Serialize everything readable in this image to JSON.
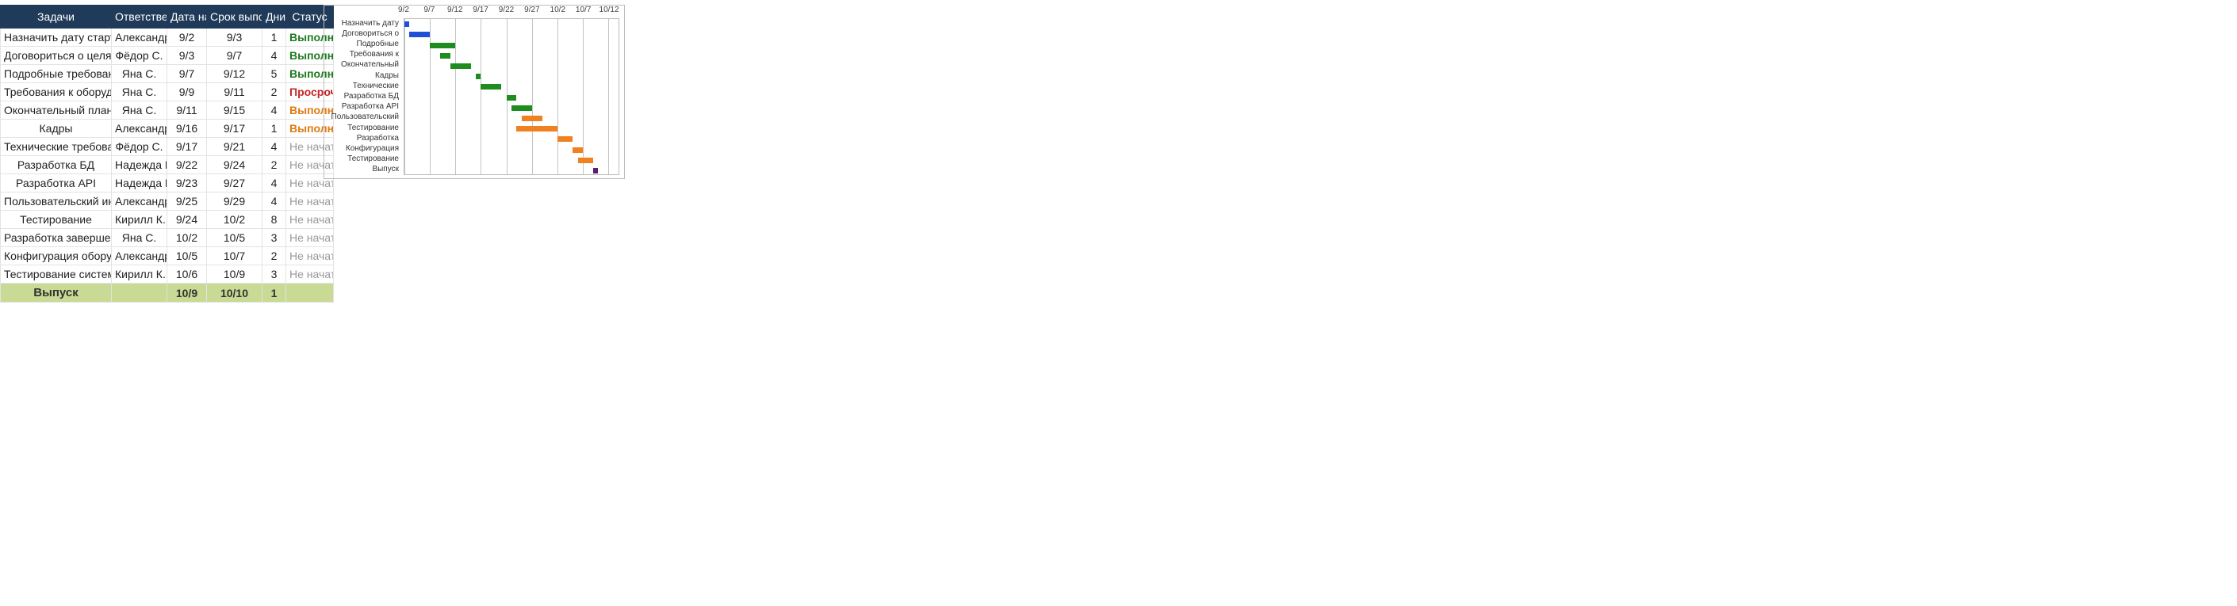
{
  "table": {
    "headers": {
      "task": "Задачи",
      "owner": "Ответственное лицо",
      "start": "Дата начала",
      "end": "Срок выполнения",
      "days": "Дни",
      "status": "Статус"
    },
    "rows": [
      {
        "task": "Назначить дату стартового совещания",
        "owner": "Александр Б.",
        "start": "9/2",
        "end": "9/3",
        "days": "1",
        "status": "Выполнено",
        "status_kind": "done"
      },
      {
        "task": "Договориться о целях",
        "owner": "Фёдор С.",
        "start": "9/3",
        "end": "9/7",
        "days": "4",
        "status": "Выполнено",
        "status_kind": "done"
      },
      {
        "task": "Подробные требования",
        "owner": "Яна С.",
        "start": "9/7",
        "end": "9/12",
        "days": "5",
        "status": "Выполнено",
        "status_kind": "done"
      },
      {
        "task": "Требования к оборудованию",
        "owner": "Яна С.",
        "start": "9/9",
        "end": "9/11",
        "days": "2",
        "status": "Просрочено",
        "status_kind": "late"
      },
      {
        "task": "Окончательный план ресурсов",
        "owner": "Яна С.",
        "start": "9/11",
        "end": "9/15",
        "days": "4",
        "status": "Выполняется",
        "status_kind": "progress"
      },
      {
        "task": "Кадры",
        "owner": "Александр Б.",
        "start": "9/16",
        "end": "9/17",
        "days": "1",
        "status": "Выполняется",
        "status_kind": "progress"
      },
      {
        "task": "Технические требования",
        "owner": "Фёдор С.",
        "start": "9/17",
        "end": "9/21",
        "days": "4",
        "status": "Не начато",
        "status_kind": "none"
      },
      {
        "task": "Разработка БД",
        "owner": "Надежда В.",
        "start": "9/22",
        "end": "9/24",
        "days": "2",
        "status": "Не начато",
        "status_kind": "none"
      },
      {
        "task": "Разработка API",
        "owner": "Надежда В.",
        "start": "9/23",
        "end": "9/27",
        "days": "4",
        "status": "Не начато",
        "status_kind": "none"
      },
      {
        "task": "Пользовательский интерфейс клиента",
        "owner": "Александр Б.",
        "start": "9/25",
        "end": "9/29",
        "days": "4",
        "status": "Не начато",
        "status_kind": "none"
      },
      {
        "task": "Тестирование",
        "owner": "Кирилл К.",
        "start": "9/24",
        "end": "10/2",
        "days": "8",
        "status": "Не начато",
        "status_kind": "none"
      },
      {
        "task": "Разработка завершена",
        "owner": "Яна С.",
        "start": "10/2",
        "end": "10/5",
        "days": "3",
        "status": "Не начато",
        "status_kind": "none"
      },
      {
        "task": "Конфигурация оборудования",
        "owner": "Александр Б.",
        "start": "10/5",
        "end": "10/7",
        "days": "2",
        "status": "Не начато",
        "status_kind": "none"
      },
      {
        "task": "Тестирование системы",
        "owner": "Кирилл К.",
        "start": "10/6",
        "end": "10/9",
        "days": "3",
        "status": "Не начато",
        "status_kind": "none"
      },
      {
        "task": "Выпуск",
        "owner": "",
        "start": "10/9",
        "end": "10/10",
        "days": "1",
        "status": "",
        "status_kind": "release"
      }
    ]
  },
  "chart_data": {
    "type": "bar",
    "orientation": "horizontal-gantt",
    "axis": {
      "min": 0,
      "max": 42
    },
    "ticks": [
      {
        "label": "9/2",
        "day": 0
      },
      {
        "label": "9/7",
        "day": 5
      },
      {
        "label": "9/12",
        "day": 10
      },
      {
        "label": "9/17",
        "day": 15
      },
      {
        "label": "9/22",
        "day": 20
      },
      {
        "label": "9/27",
        "day": 25
      },
      {
        "label": "10/2",
        "day": 30
      },
      {
        "label": "10/7",
        "day": 35
      },
      {
        "label": "10/12",
        "day": 40
      }
    ],
    "tasks": [
      {
        "label": "Назначить дату стартового совещания",
        "start": 0,
        "dur": 1,
        "color": "blue"
      },
      {
        "label": "Договориться о целях",
        "start": 1,
        "dur": 4,
        "color": "blue"
      },
      {
        "label": "Подробные требования",
        "start": 5,
        "dur": 5,
        "color": "green"
      },
      {
        "label": "Требования к оборудованию",
        "start": 7,
        "dur": 2,
        "color": "green"
      },
      {
        "label": "Окончательный план ресурсов",
        "start": 9,
        "dur": 4,
        "color": "green"
      },
      {
        "label": "Кадры",
        "start": 14,
        "dur": 1,
        "color": "green"
      },
      {
        "label": "Технические требования",
        "start": 15,
        "dur": 4,
        "color": "green"
      },
      {
        "label": "Разработка БД",
        "start": 20,
        "dur": 2,
        "color": "green"
      },
      {
        "label": "Разработка API",
        "start": 21,
        "dur": 4,
        "color": "green"
      },
      {
        "label": "Пользовательский интерфейс клиента",
        "start": 23,
        "dur": 4,
        "color": "orange"
      },
      {
        "label": "Тестирование",
        "start": 22,
        "dur": 8,
        "color": "orange"
      },
      {
        "label": "Разработка завершена",
        "start": 30,
        "dur": 3,
        "color": "orange"
      },
      {
        "label": "Конфигурация оборудования",
        "start": 33,
        "dur": 2,
        "color": "orange"
      },
      {
        "label": "Тестирование системы",
        "start": 34,
        "dur": 3,
        "color": "orange"
      },
      {
        "label": "Выпуск",
        "start": 37,
        "dur": 1,
        "color": "purple"
      }
    ]
  }
}
